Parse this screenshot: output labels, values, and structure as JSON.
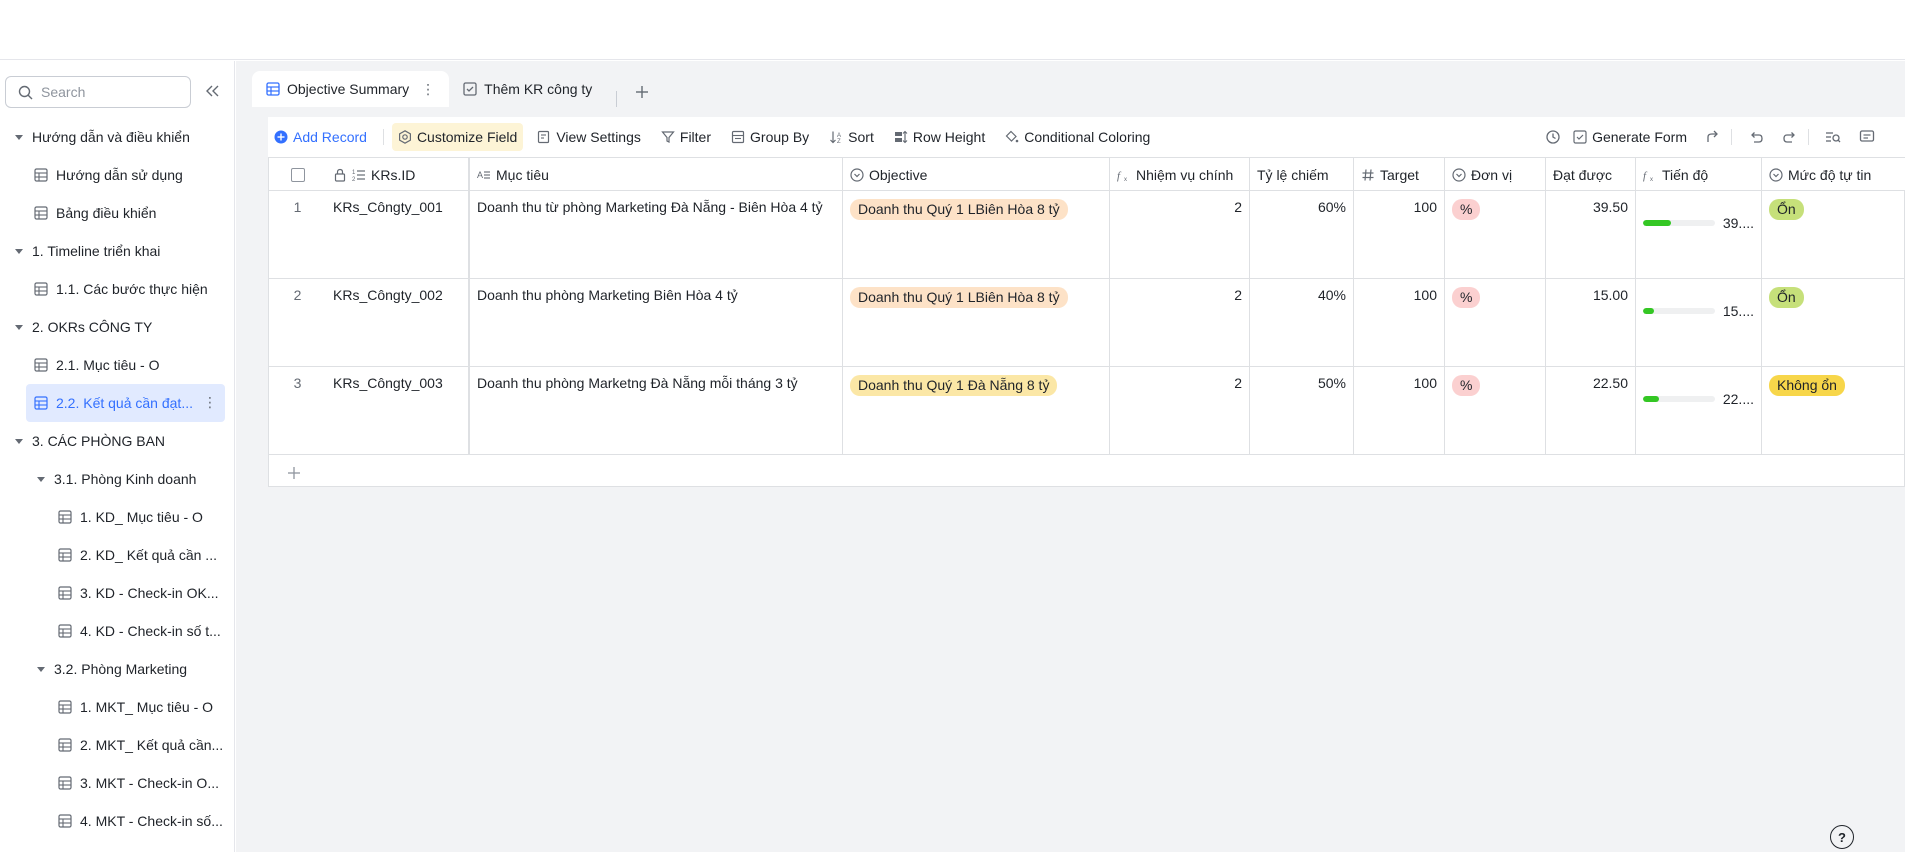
{
  "sidebar": {
    "search_placeholder": "Search",
    "tree": [
      {
        "label": "Hướng dẫn và điều khiển",
        "level": 0,
        "type": "folder"
      },
      {
        "label": "Hướng dẫn sử dụng",
        "level": 1,
        "type": "table"
      },
      {
        "label": "Bảng điều khiển",
        "level": 1,
        "type": "table"
      },
      {
        "label": "1. Timeline triển khai",
        "level": 0,
        "type": "folder"
      },
      {
        "label": "1.1. Các bước thực hiện",
        "level": 1,
        "type": "table"
      },
      {
        "label": "2. OKRs CÔNG TY",
        "level": 0,
        "type": "folder"
      },
      {
        "label": "2.1. Mục tiêu - O",
        "level": 1,
        "type": "table"
      },
      {
        "label": "2.2. Kết quả cần đạt...",
        "level": 1,
        "type": "table",
        "active": true
      },
      {
        "label": "3. CÁC PHÒNG BAN",
        "level": 0,
        "type": "folder"
      },
      {
        "label": "3.1. Phòng Kinh doanh",
        "level": 1,
        "type": "folder"
      },
      {
        "label": "1. KD_ Mục tiêu - O",
        "level": 2,
        "type": "table"
      },
      {
        "label": "2. KD_ Kết quả cần ...",
        "level": 2,
        "type": "table"
      },
      {
        "label": "3. KD - Check-in OK...",
        "level": 2,
        "type": "table"
      },
      {
        "label": "4. KD - Check-in số t...",
        "level": 2,
        "type": "table"
      },
      {
        "label": "3.2. Phòng Marketing",
        "level": 1,
        "type": "folder"
      },
      {
        "label": "1. MKT_ Mục tiêu - O",
        "level": 2,
        "type": "table"
      },
      {
        "label": "2. MKT_ Kết quả cần...",
        "level": 2,
        "type": "table"
      },
      {
        "label": "3. MKT - Check-in O...",
        "level": 2,
        "type": "table"
      },
      {
        "label": "4. MKT - Check-in số...",
        "level": 2,
        "type": "table"
      }
    ]
  },
  "tabs": [
    {
      "label": "Objective Summary",
      "active": true
    },
    {
      "label": "Thêm KR công ty",
      "active": false
    }
  ],
  "toolbar": {
    "add_record": "Add Record",
    "customize_field": "Customize Field",
    "view_settings": "View Settings",
    "filter": "Filter",
    "group_by": "Group By",
    "sort": "Sort",
    "row_height": "Row Height",
    "conditional_coloring": "Conditional Coloring",
    "generate_form": "Generate Form"
  },
  "columns": {
    "krs_id": "KRs.ID",
    "muc_tieu": "Mục tiêu",
    "objective": "Objective",
    "nhiem_vu": "Nhiệm vụ chính",
    "ty_le": "Tỷ lệ chiếm",
    "target": "Target",
    "don_vi": "Đơn vị",
    "dat_duoc": "Đạt được",
    "tien_do": "Tiến độ",
    "muc_do": "Mức độ tự tin"
  },
  "rows": [
    {
      "num": "1",
      "krs_id": "KRs_Côngty_001",
      "muc_tieu": "Doanh thu từ phòng Marketing Đà Nẵng - Biên Hòa 4 tỷ",
      "objective": "Doanh thu Quý 1 LBiên Hòa 8 tỷ",
      "nhiem_vu": "2",
      "ty_le": "60%",
      "target": "100",
      "don_vi": "%",
      "dat_duoc": "39.50",
      "tien_do_label": "39....",
      "tien_do_fraction": 0.395,
      "muc_do": "Ổn"
    },
    {
      "num": "2",
      "krs_id": "KRs_Côngty_002",
      "muc_tieu": "Doanh thu phòng Marketing Biên Hòa 4 tỷ",
      "objective": "Doanh thu Quý 1 LBiên Hòa 8 tỷ",
      "nhiem_vu": "2",
      "ty_le": "40%",
      "target": "100",
      "don_vi": "%",
      "dat_duoc": "15.00",
      "tien_do_label": "15....",
      "tien_do_fraction": 0.15,
      "muc_do": "Ổn"
    },
    {
      "num": "3",
      "krs_id": "KRs_Côngty_003",
      "muc_tieu": "Doanh thu phòng Marketng Đà Nẵng mỗi tháng 3 tỷ",
      "objective": "Doanh thu Quý 1  Đà Nẵng 8 tỷ",
      "nhiem_vu": "2",
      "ty_le": "50%",
      "target": "100",
      "don_vi": "%",
      "dat_duoc": "22.50",
      "tien_do_label": "22....",
      "tien_do_fraction": 0.225,
      "muc_do": "Không ổn"
    }
  ],
  "colors": {
    "accent": "#3370ff",
    "progress_fill": "#34c724",
    "tag_objective_orange": "#fde2c7",
    "tag_objective_yellow": "#fbe7a6",
    "tag_unit_pink": "#fbd0d0",
    "tag_on_green": "#c6e07a",
    "tag_khongon_yellow": "#f7d64a"
  },
  "help": "?"
}
